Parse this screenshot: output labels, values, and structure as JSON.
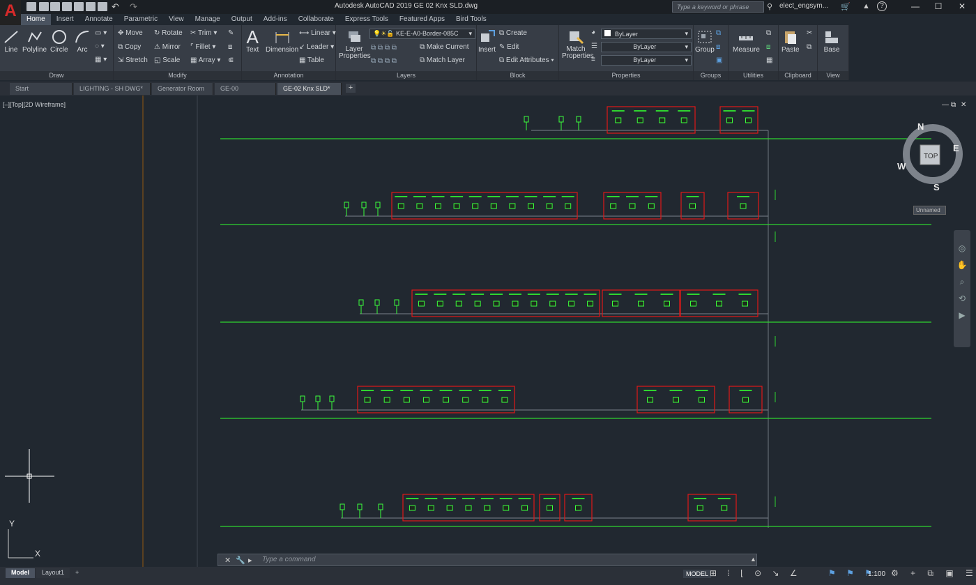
{
  "app": {
    "logo": "A",
    "title": "Autodesk AutoCAD 2019   GE 02 Knx SLD.dwg",
    "search_placeholder": "Type a keyword or phrase",
    "user": "elect_engsym...",
    "help": "?"
  },
  "menu_tabs": [
    "Home",
    "Insert",
    "Annotate",
    "Parametric",
    "View",
    "Manage",
    "Output",
    "Add-ins",
    "Collaborate",
    "Express Tools",
    "Featured Apps",
    "Bird Tools"
  ],
  "ribbon": {
    "draw": {
      "title": "Draw",
      "line": "Line",
      "polyline": "Polyline",
      "circle": "Circle",
      "arc": "Arc"
    },
    "modify": {
      "title": "Modify",
      "move": "Move",
      "rotate": "Rotate",
      "trim": "Trim",
      "copy": "Copy",
      "mirror": "Mirror",
      "fillet": "Fillet",
      "stretch": "Stretch",
      "scale": "Scale",
      "array": "Array"
    },
    "annotation": {
      "title": "Annotation",
      "text": "Text",
      "dimension": "Dimension",
      "linear": "Linear",
      "leader": "Leader",
      "table": "Table"
    },
    "layers": {
      "title": "Layers",
      "layer_properties": "Layer Properties",
      "layer_combo": "KE-E-A0-Border-085C",
      "make_current": "Make Current",
      "match_layer": "Match Layer"
    },
    "block": {
      "title": "Block",
      "insert": "Insert",
      "create": "Create",
      "edit": "Edit",
      "edit_attributes": "Edit Attributes"
    },
    "properties": {
      "title": "Properties",
      "match": "Match Properties",
      "color": "ByLayer",
      "linetype": "ByLayer",
      "lineweight": "ByLayer"
    },
    "groups": {
      "title": "Groups",
      "group": "Group"
    },
    "utilities": {
      "title": "Utilities",
      "measure": "Measure"
    },
    "clipboard": {
      "title": "Clipboard",
      "paste": "Paste"
    },
    "view": {
      "title": "View",
      "base": "Base"
    }
  },
  "doc_tabs": [
    "Start",
    "LIGHTING - SH DWG*",
    "Generator Room",
    "GE-00",
    "GE-02 Knx SLD*"
  ],
  "viewport_label": "[–][Top][2D Wireframe]",
  "viewcube": {
    "face": "TOP",
    "n": "N",
    "e": "E",
    "s": "S",
    "w": "W",
    "named_view": "Unnamed"
  },
  "ucs": {
    "x": "X",
    "y": "Y"
  },
  "command": {
    "placeholder": "Type a command"
  },
  "status": {
    "model_tab": "Model",
    "layout_tab": "Layout1",
    "mode": "MODEL",
    "scale": "1:100"
  }
}
